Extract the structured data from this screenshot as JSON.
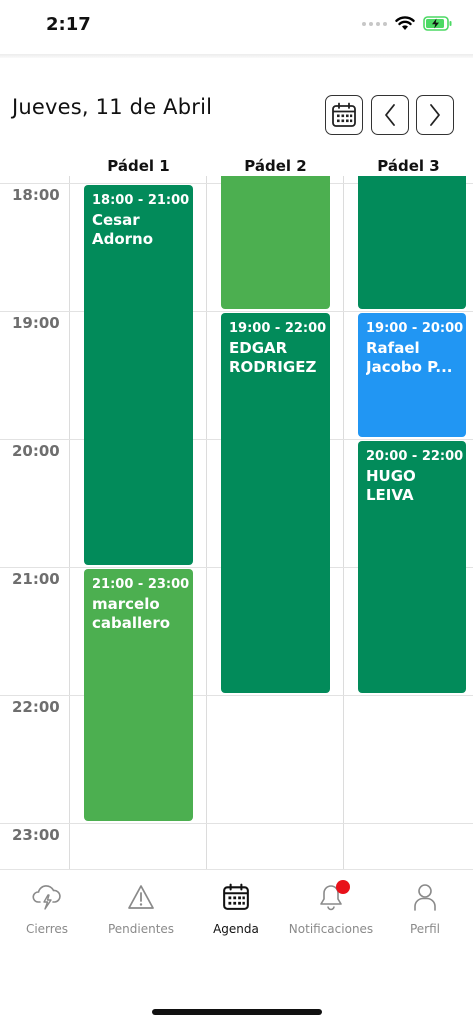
{
  "status_bar": {
    "time": "2:17"
  },
  "header": {
    "date": "Jueves, 11 de Abril"
  },
  "columns": [
    "Pádel 1",
    "Pádel 2",
    "Pádel 3"
  ],
  "time_slots": [
    "18:00",
    "19:00",
    "20:00",
    "21:00",
    "22:00",
    "23:00"
  ],
  "events": [
    {
      "time": "18:00 - 21:00",
      "name": "Cesar Adorno"
    },
    {
      "time": "21:00 - 23:00",
      "name": "marcelo caballero"
    },
    {
      "time": "",
      "name": ""
    },
    {
      "time": "19:00 - 22:00",
      "name": "EDGAR RODRIGEZ"
    },
    {
      "time": "",
      "name": ""
    },
    {
      "time": "19:00 - 20:00",
      "name": "Rafael Jacobo P..."
    },
    {
      "time": "20:00 - 22:00",
      "name": "HUGO LEIVA"
    }
  ],
  "colors": {
    "dark_green": "#028b5a",
    "light_green": "#4caf50",
    "blue": "#2196f3",
    "notification": "#e8111a"
  },
  "tabs": [
    {
      "label": "Cierres",
      "icon": "storm-cloud-icon"
    },
    {
      "label": "Pendientes",
      "icon": "warning-icon"
    },
    {
      "label": "Agenda",
      "icon": "calendar-icon",
      "active": true
    },
    {
      "label": "Notificaciones",
      "icon": "bell-icon"
    },
    {
      "label": "Perfil",
      "icon": "person-icon"
    }
  ]
}
